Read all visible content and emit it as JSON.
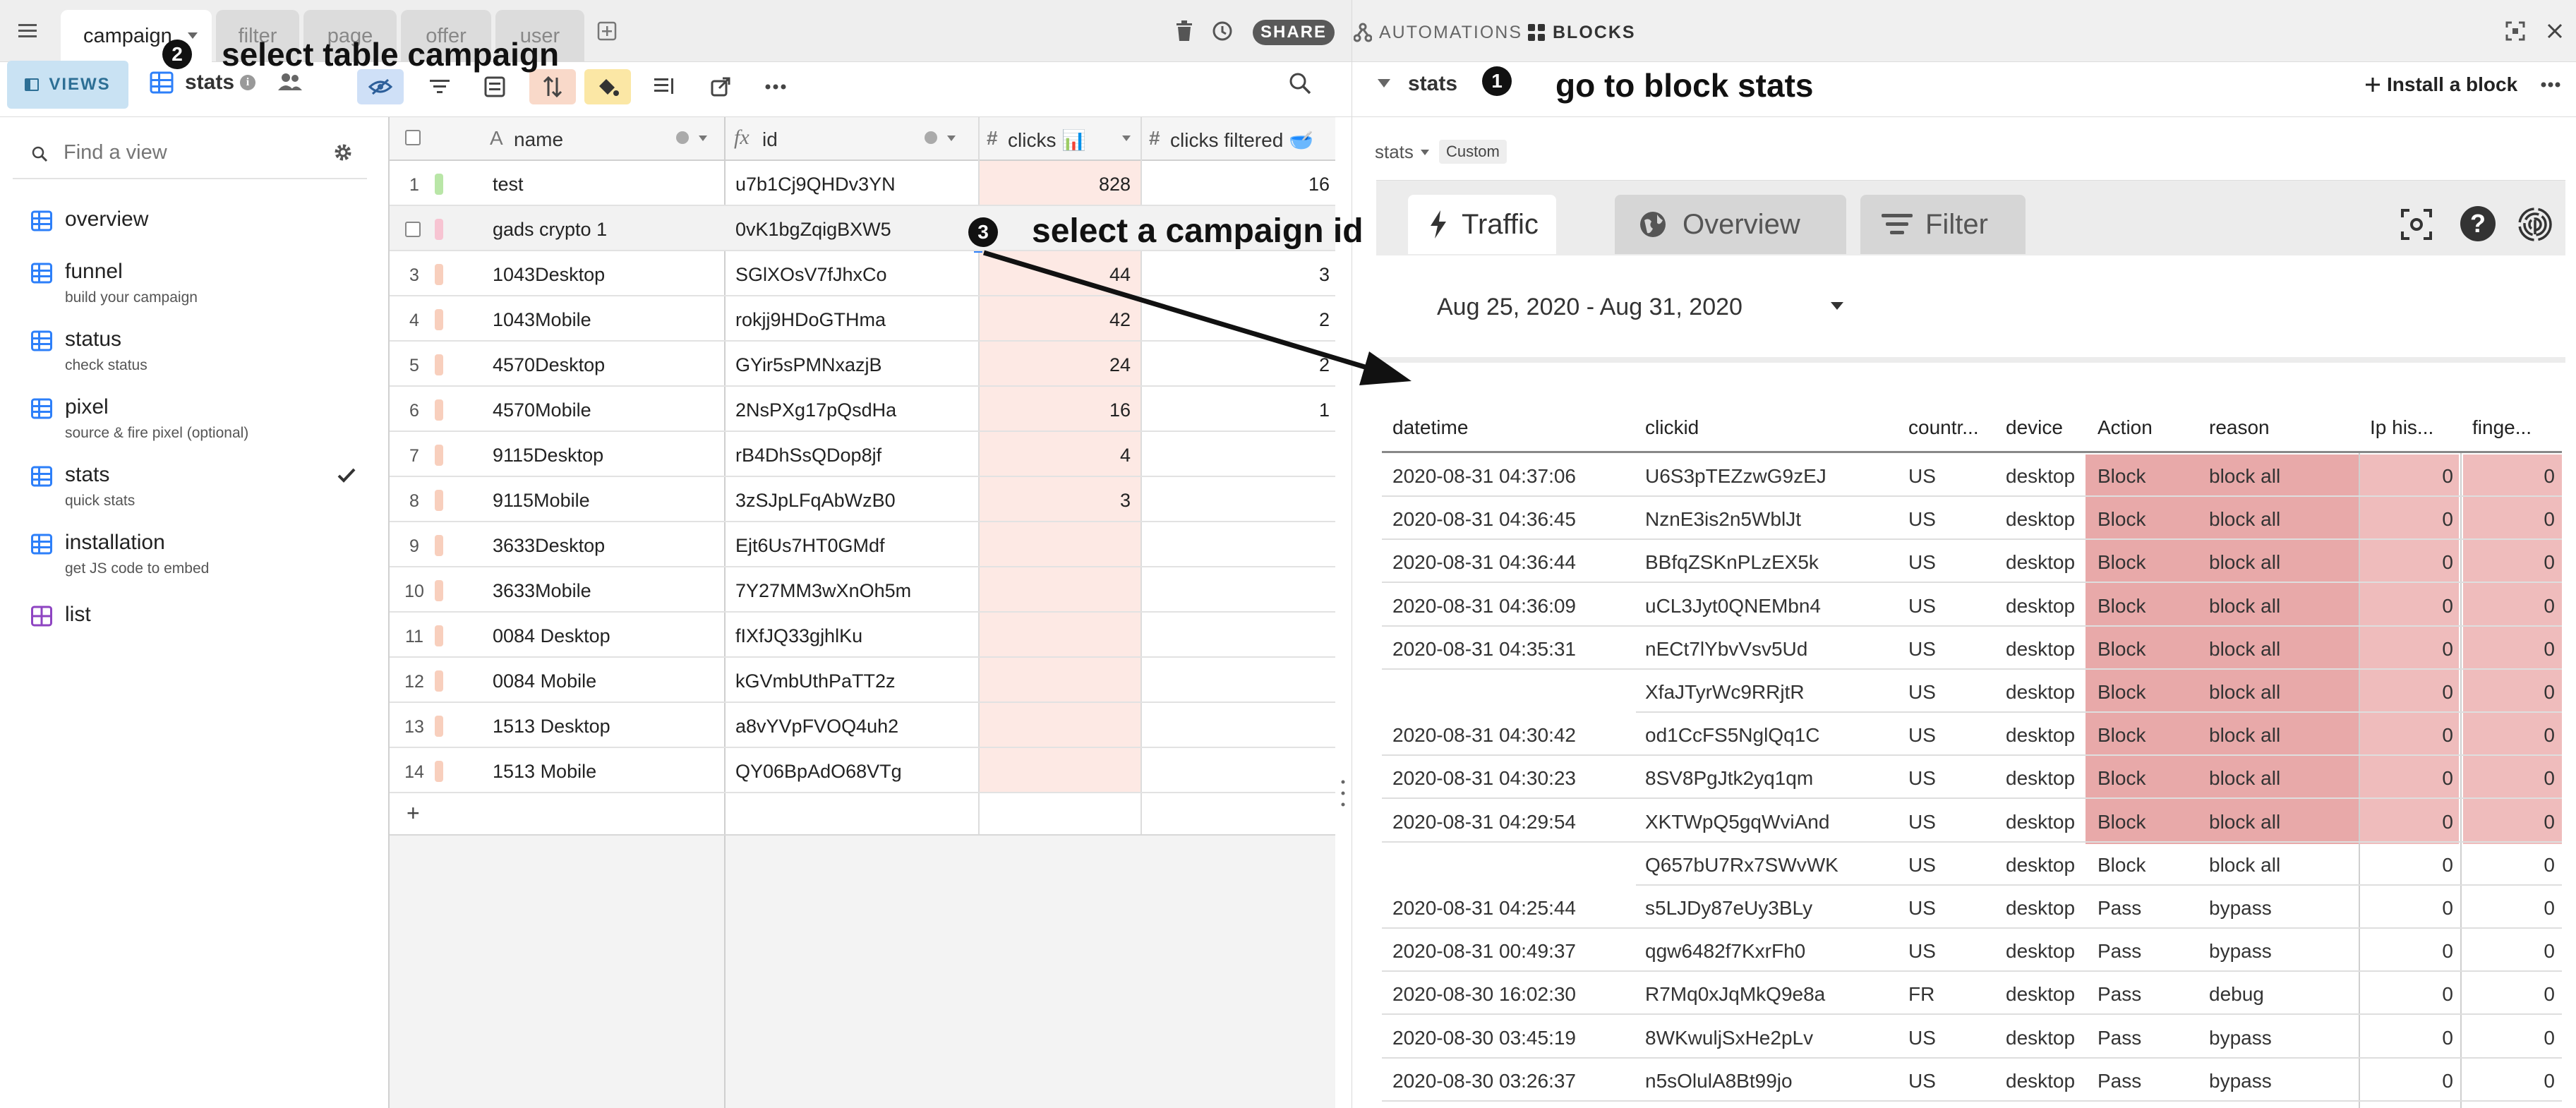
{
  "topbar": {
    "tabs": [
      "campaign",
      "filter",
      "page",
      "offer",
      "user"
    ],
    "share": "SHARE",
    "automations": "AUTOMATIONS",
    "blocks": "BLOCKS"
  },
  "toolbar": {
    "views": "VIEWS",
    "view_name": "stats"
  },
  "sidebar": {
    "search_placeholder": "Find a view",
    "views": [
      {
        "name": "overview",
        "sub": ""
      },
      {
        "name": "funnel",
        "sub": "build your campaign"
      },
      {
        "name": "status",
        "sub": "check status"
      },
      {
        "name": "pixel",
        "sub": "source & fire pixel (optional)"
      },
      {
        "name": "stats",
        "sub": "quick stats"
      },
      {
        "name": "installation",
        "sub": "get JS code to embed"
      },
      {
        "name": "list",
        "sub": ""
      }
    ]
  },
  "grid": {
    "columns": [
      "name",
      "id",
      "clicks 📊",
      "clicks filtered 🥣"
    ],
    "rows": [
      {
        "n": "1",
        "name": "test",
        "id": "u7b1Cj9QHDv3YN",
        "clicks": "828",
        "filtered": "16"
      },
      {
        "n": "",
        "name": "gads crypto 1",
        "id": "0vK1bgZqigBXW5",
        "clicks": "",
        "filtered": ""
      },
      {
        "n": "3",
        "name": "1043Desktop",
        "id": "SGlXOsV7fJhxCo",
        "clicks": "44",
        "filtered": "3"
      },
      {
        "n": "4",
        "name": "1043Mobile",
        "id": "rokjj9HDoGTHma",
        "clicks": "42",
        "filtered": "2"
      },
      {
        "n": "5",
        "name": "4570Desktop",
        "id": "GYir5sPMNxazjB",
        "clicks": "24",
        "filtered": "2"
      },
      {
        "n": "6",
        "name": "4570Mobile",
        "id": "2NsPXg17pQsdHa",
        "clicks": "16",
        "filtered": "1"
      },
      {
        "n": "7",
        "name": "9115Desktop",
        "id": "rB4DhSsQDop8jf",
        "clicks": "4",
        "filtered": ""
      },
      {
        "n": "8",
        "name": "9115Mobile",
        "id": "3zSJpLFqAbWzB0",
        "clicks": "3",
        "filtered": ""
      },
      {
        "n": "9",
        "name": "3633Desktop",
        "id": "Ejt6Us7HT0GMdf",
        "clicks": "",
        "filtered": ""
      },
      {
        "n": "10",
        "name": "3633Mobile",
        "id": "7Y27MM3wXnOh5m",
        "clicks": "",
        "filtered": ""
      },
      {
        "n": "11",
        "name": "0084 Desktop",
        "id": "fIXfJQ33gjhlKu",
        "clicks": "",
        "filtered": ""
      },
      {
        "n": "12",
        "name": "0084 Mobile",
        "id": "kGVmbUthPaTT2z",
        "clicks": "",
        "filtered": ""
      },
      {
        "n": "13",
        "name": "1513 Desktop",
        "id": "a8vYVpFVOQ4uh2",
        "clicks": "",
        "filtered": ""
      },
      {
        "n": "14",
        "name": "1513 Mobile",
        "id": "QY06BpAdO68VTg",
        "clicks": "",
        "filtered": ""
      }
    ],
    "add": "+"
  },
  "block": {
    "header": "stats",
    "install": "Install a block",
    "crumb": "stats",
    "crumb_badge": "Custom",
    "tabs": [
      "Traffic",
      "Overview",
      "Filter"
    ],
    "date_range": "Aug 25, 2020 - Aug 31, 2020",
    "columns": [
      "datetime",
      "clickid",
      "countr...",
      "device",
      "Action",
      "reason",
      "Ip his...",
      "finge..."
    ],
    "rows": [
      {
        "dt": "2020-08-31 04:37:06",
        "id": "U6S3pTEZzwG9zEJ",
        "c": "US",
        "d": "desktop",
        "a": "Block",
        "r": "block all",
        "ip": "0",
        "fp": "0"
      },
      {
        "dt": "2020-08-31 04:36:45",
        "id": "NznE3is2n5WblJt",
        "c": "US",
        "d": "desktop",
        "a": "Block",
        "r": "block all",
        "ip": "0",
        "fp": "0"
      },
      {
        "dt": "2020-08-31 04:36:44",
        "id": "BBfqZSKnPLzEX5k",
        "c": "US",
        "d": "desktop",
        "a": "Block",
        "r": "block all",
        "ip": "0",
        "fp": "0"
      },
      {
        "dt": "2020-08-31 04:36:09",
        "id": "uCL3Jyt0QNEMbn4",
        "c": "US",
        "d": "desktop",
        "a": "Block",
        "r": "block all",
        "ip": "0",
        "fp": "0"
      },
      {
        "dt": "2020-08-31 04:35:31",
        "id": "nECt7lYbvVsv5Ud",
        "c": "US",
        "d": "desktop",
        "a": "Block",
        "r": "block all",
        "ip": "0",
        "fp": "0"
      },
      {
        "dt": "",
        "id": "XfaJTyrWc9RRjtR",
        "c": "US",
        "d": "desktop",
        "a": "Block",
        "r": "block all",
        "ip": "0",
        "fp": "0"
      },
      {
        "dt": "2020-08-31 04:30:42",
        "id": "od1CcFS5NglQq1C",
        "c": "US",
        "d": "desktop",
        "a": "Block",
        "r": "block all",
        "ip": "0",
        "fp": "0"
      },
      {
        "dt": "2020-08-31 04:30:23",
        "id": "8SV8PgJtk2yq1qm",
        "c": "US",
        "d": "desktop",
        "a": "Block",
        "r": "block all",
        "ip": "0",
        "fp": "0"
      },
      {
        "dt": "2020-08-31 04:29:54",
        "id": "XKTWpQ5gqWviAnd",
        "c": "US",
        "d": "desktop",
        "a": "Block",
        "r": "block all",
        "ip": "0",
        "fp": "0"
      },
      {
        "dt": "",
        "id": "Q657bU7Rx7SWvWK",
        "c": "US",
        "d": "desktop",
        "a": "Block",
        "r": "block all",
        "ip": "0",
        "fp": "0"
      },
      {
        "dt": "2020-08-31 04:25:44",
        "id": "s5LJDy87eUy3BLy",
        "c": "US",
        "d": "desktop",
        "a": "Pass",
        "r": "bypass",
        "ip": "0",
        "fp": "0"
      },
      {
        "dt": "2020-08-31 00:49:37",
        "id": "qgw6482f7KxrFh0",
        "c": "US",
        "d": "desktop",
        "a": "Pass",
        "r": "bypass",
        "ip": "0",
        "fp": "0"
      },
      {
        "dt": "2020-08-30 16:02:30",
        "id": "R7Mq0xJqMkQ9e8a",
        "c": "FR",
        "d": "desktop",
        "a": "Pass",
        "r": "debug",
        "ip": "0",
        "fp": "0"
      },
      {
        "dt": "2020-08-30 03:45:19",
        "id": "8WKwuljSxHe2pLv",
        "c": "US",
        "d": "desktop",
        "a": "Pass",
        "r": "bypass",
        "ip": "0",
        "fp": "0"
      },
      {
        "dt": "2020-08-30 03:26:37",
        "id": "n5sOlulA8Bt99jo",
        "c": "US",
        "d": "desktop",
        "a": "Pass",
        "r": "bypass",
        "ip": "0",
        "fp": "0"
      }
    ]
  },
  "annotations": {
    "step1": {
      "num": "1",
      "text": "go to block stats"
    },
    "step2": {
      "num": "2",
      "text": "select table campaign"
    },
    "step3": {
      "num": "3",
      "text": "select a campaign id"
    }
  },
  "colors": {
    "accent": "#2d7ff9",
    "block_red": "#e8a9a9",
    "clicks_tint": "#fde9e4"
  }
}
